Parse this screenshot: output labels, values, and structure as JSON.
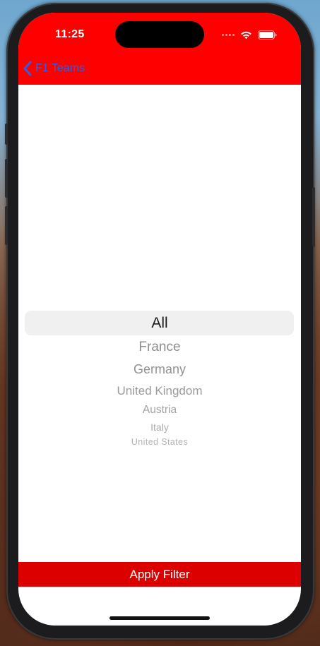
{
  "status_bar": {
    "time": "11:25"
  },
  "nav": {
    "back_label": "F1 Teams",
    "back_icon": "chevron-left-icon"
  },
  "picker": {
    "selected": "All",
    "options": [
      "All",
      "France",
      "Germany",
      "United Kingdom",
      "Austria",
      "Italy",
      "United States"
    ]
  },
  "apply_button": {
    "label": "Apply Filter"
  },
  "colors": {
    "header_bg": "#ff0000",
    "back_link": "#2f5fe0",
    "apply_bg": "#dd0000",
    "picker_highlight": "#f0f0f0"
  }
}
